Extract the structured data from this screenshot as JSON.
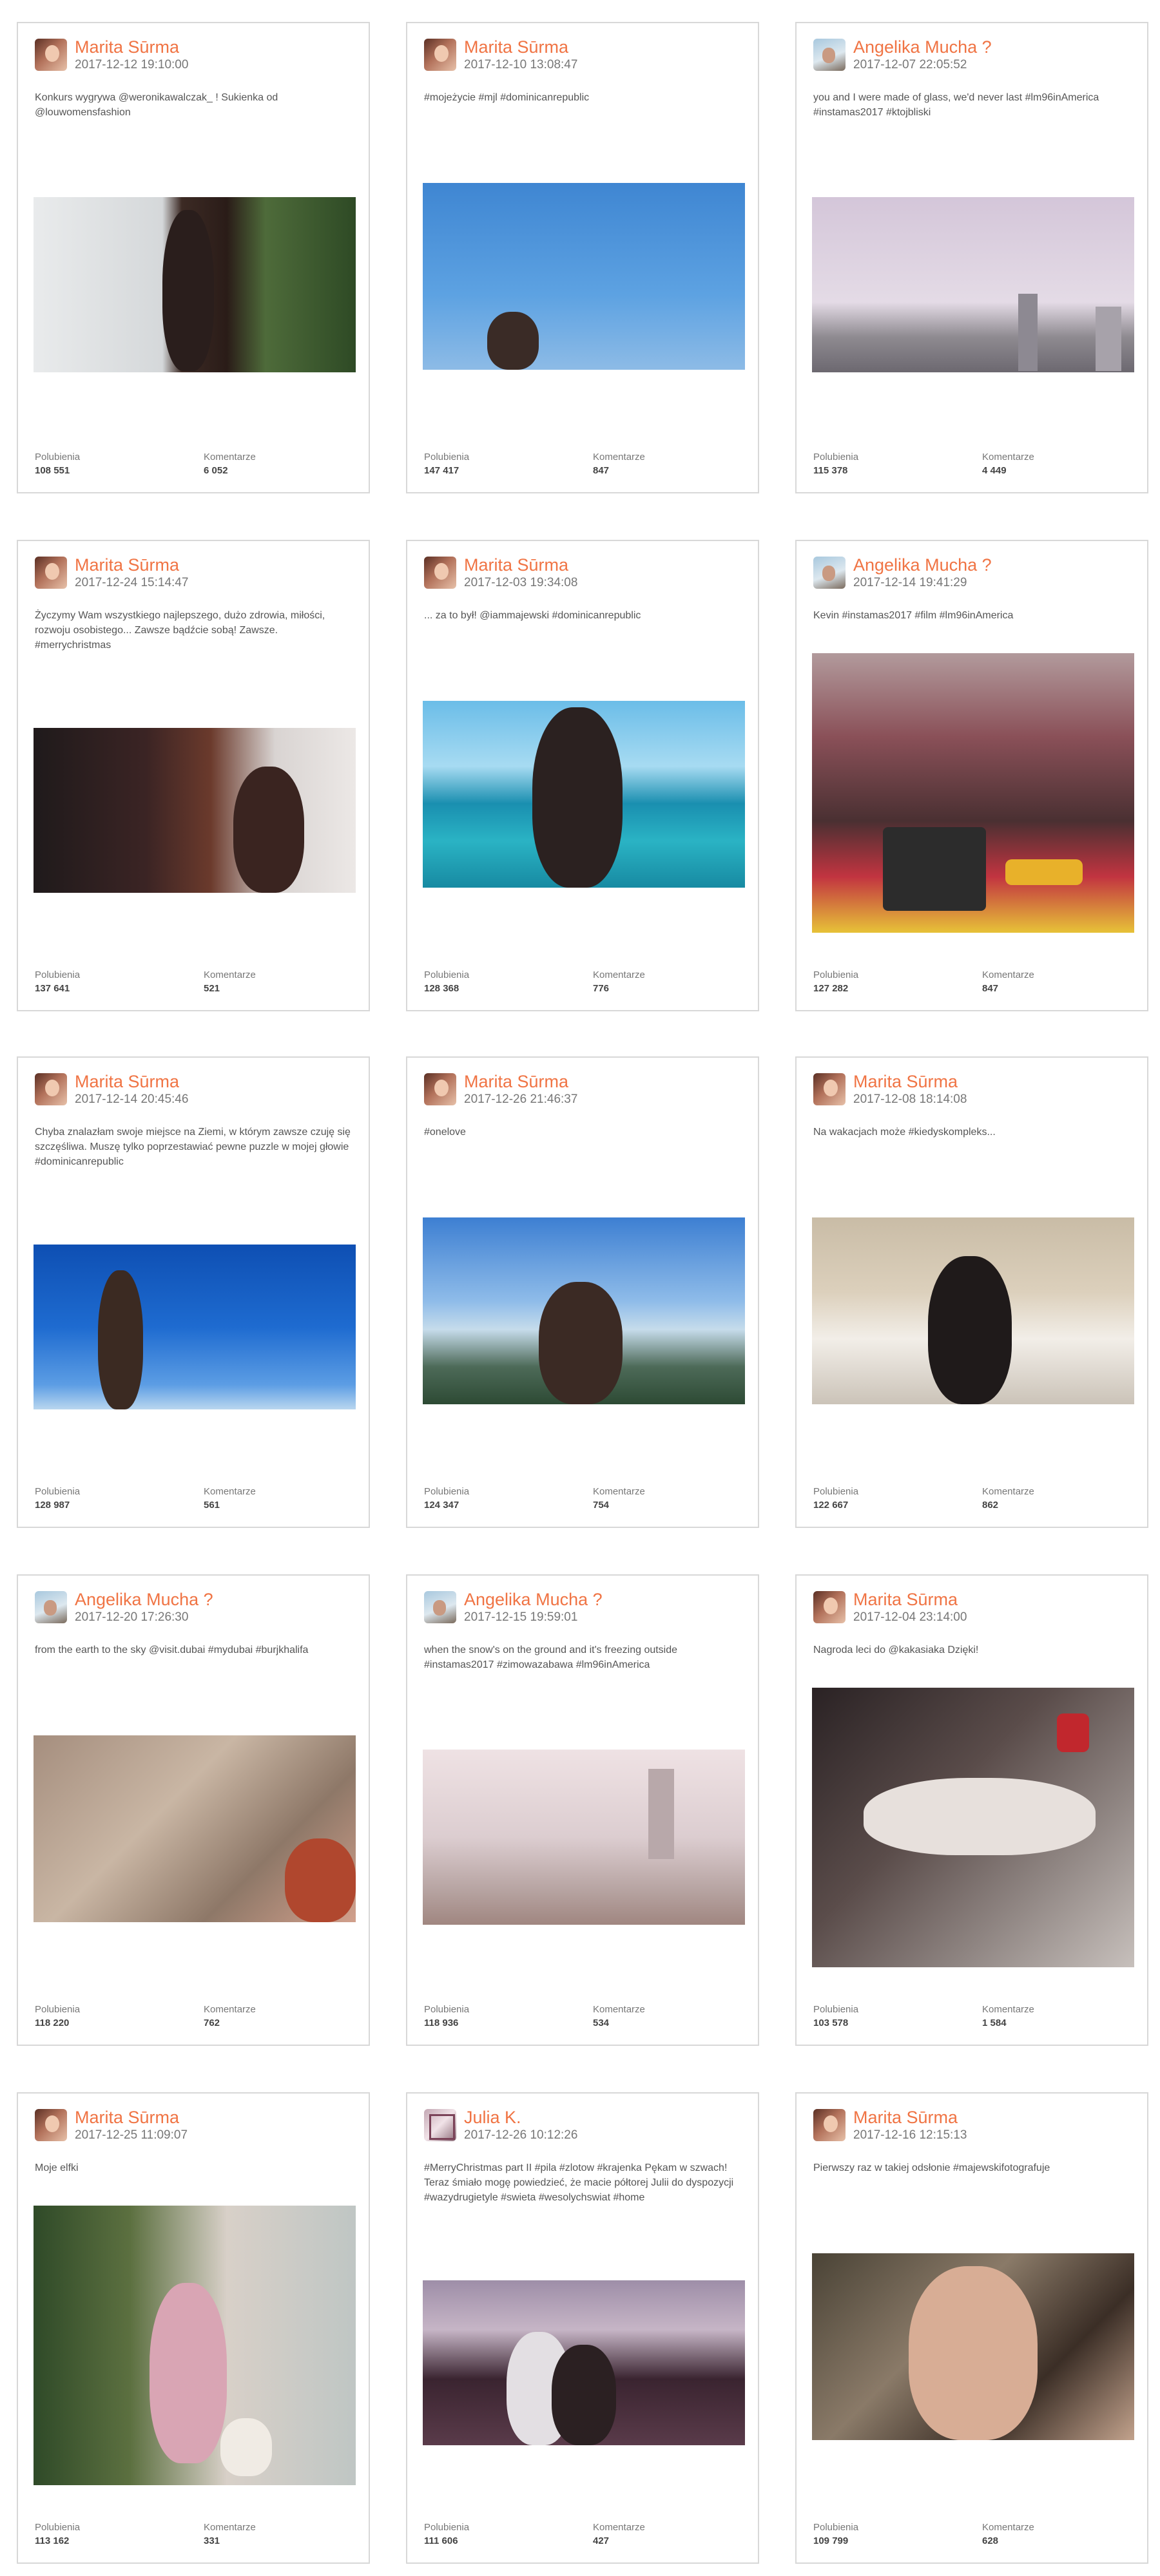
{
  "labels": {
    "likes": "Polubienia",
    "comments": "Komentarze"
  },
  "accent_color": "#f07444",
  "posts": [
    {
      "author": "Marita Sūrma",
      "date": "2017-12-12 19:10:00",
      "caption": "Konkurs wygrywa @weronikawalczak_ ! Sukienka od @louwomensfashion",
      "likes": "108 551",
      "comments": "6 052",
      "avatar": "marita-avatar",
      "image": "woman-in-dress-photo"
    },
    {
      "author": "Marita Sūrma",
      "date": "2017-12-10 13:08:47",
      "caption": "#mojeżycie #mjl #dominicanrepublic",
      "likes": "147 417",
      "comments": "847",
      "avatar": "marita-avatar",
      "image": "swing-sky-photo"
    },
    {
      "author": "Angelika Mucha ?",
      "date": "2017-12-07 22:05:52",
      "caption": "you and I were made of glass, we'd never last #lm96inAmerica #instamas2017 #ktojbliski",
      "likes": "115 378",
      "comments": "4 449",
      "avatar": "angelika-avatar",
      "image": "city-skyline-photo"
    },
    {
      "author": "Marita Sūrma",
      "date": "2017-12-24 15:14:47",
      "caption": "Życzymy Wam wszystkiego najlepszego, dużo zdrowia, miłości, rozwoju osobistego... Zawsze bądźcie sobą! Zawsze. #merrychristmas",
      "likes": "137 641",
      "comments": "521",
      "avatar": "marita-avatar",
      "image": "christmas-selfie-photo"
    },
    {
      "author": "Marita Sūrma",
      "date": "2017-12-03 19:34:08",
      "caption": "... za to był! @iammajewski #dominicanrepublic",
      "likes": "128 368",
      "comments": "776",
      "avatar": "marita-avatar",
      "image": "sea-selfie-photo"
    },
    {
      "author": "Angelika Mucha ?",
      "date": "2017-12-14 19:41:29",
      "caption": "Kevin #instamas2017 #film #lm96inAmerica",
      "likes": "127 282",
      "comments": "847",
      "avatar": "angelika-avatar",
      "image": "radio-city-photo"
    },
    {
      "author": "Marita Sūrma",
      "date": "2017-12-14 20:45:46",
      "caption": "Chyba znalazłam swoje miejsce na Ziemi, w którym zawsze czuję się szczęśliwa. Muszę tylko poprzestawiać pewne puzzle w mojej głowie #dominicanrepublic",
      "likes": "128 987",
      "comments": "561",
      "avatar": "marita-avatar",
      "image": "swing-blue-sky-photo"
    },
    {
      "author": "Marita Sūrma",
      "date": "2017-12-26 21:46:37",
      "caption": "#onelove",
      "likes": "124 347",
      "comments": "754",
      "avatar": "marita-avatar",
      "image": "mountain-view-photo"
    },
    {
      "author": "Marita Sūrma",
      "date": "2017-12-08 18:14:08",
      "caption": "Na wakacjach może #kiedyskompleks...",
      "likes": "122 667",
      "comments": "862",
      "avatar": "marita-avatar",
      "image": "bedroom-photo"
    },
    {
      "author": "Angelika Mucha ?",
      "date": "2017-12-20 17:26:30",
      "caption": "from the earth to the sky @visit.dubai #mydubai #burjkhalifa",
      "likes": "118 220",
      "comments": "762",
      "avatar": "angelika-avatar",
      "image": "dubai-view-photo"
    },
    {
      "author": "Angelika Mucha ?",
      "date": "2017-12-15 19:59:01",
      "caption": "when the snow's on the ground and it's freezing outside #instamas2017 #zimowazabawa #lm96inAmerica",
      "likes": "118 936",
      "comments": "534",
      "avatar": "angelika-avatar",
      "image": "snowy-park-photo"
    },
    {
      "author": "Marita Sūrma",
      "date": "2017-12-04 23:14:00",
      "caption": "Nagroda leci do @kakasiaka Dzięki!",
      "likes": "103 578",
      "comments": "1 584",
      "avatar": "marita-avatar",
      "image": "lying-pose-photo"
    },
    {
      "author": "Marita Sūrma",
      "date": "2017-12-25 11:09:07",
      "caption": "Moje elfki",
      "likes": "113 162",
      "comments": "331",
      "avatar": "marita-avatar",
      "image": "christmas-tree-photo"
    },
    {
      "author": "Julia K.",
      "date": "2017-12-26 10:12:26",
      "caption": "#MerryChristmas part II #pila #zlotow #krajenka Pękam w szwach! Teraz śmiało mogę powiedzieć, że macie półtorej Julii do dyspozycji #wazydrugietyle #swieta #wesolychswiat #home",
      "likes": "111 606",
      "comments": "427",
      "avatar": "julia-avatar",
      "image": "couple-christmas-photo"
    },
    {
      "author": "Marita Sūrma",
      "date": "2017-12-16 12:15:13",
      "caption": "Pierwszy raz w takiej odsłonie #majewskifotografuje",
      "likes": "109 799",
      "comments": "628",
      "avatar": "marita-avatar",
      "image": "portrait-photo"
    }
  ]
}
